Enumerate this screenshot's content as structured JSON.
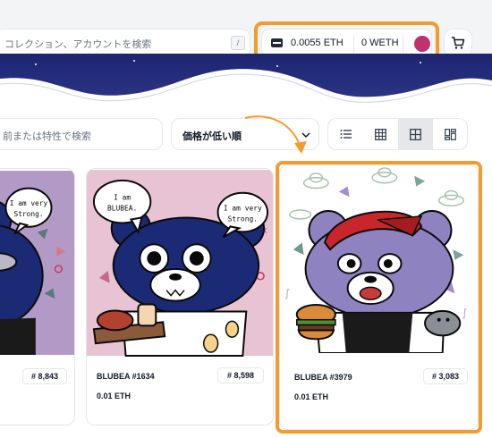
{
  "header": {
    "search_placeholder": "コレクション、アカウントを検索",
    "search_shortcut": "/",
    "wallet": {
      "eth": "0.0055 ETH",
      "weth": "0 WETH",
      "avatar_color": "#c2306f"
    },
    "highlight_color": "#f39c2e"
  },
  "filters": {
    "trait_search_placeholder": "前または特性で検索",
    "sort_label": "価格が低い順"
  },
  "cards": [
    {
      "name": "",
      "rank": "# 8,843",
      "price": ""
    },
    {
      "name": "BLUBEA #1634",
      "rank": "# 8,598",
      "price": "0.01 ETH"
    },
    {
      "name": "BLUBEA #3979",
      "rank": "# 3,083",
      "price": "0.01 ETH"
    }
  ],
  "art_text": {
    "bubble_strong": [
      "I am very",
      "Strong."
    ],
    "bubble_iam": [
      "I am",
      "BLUBEA."
    ]
  }
}
